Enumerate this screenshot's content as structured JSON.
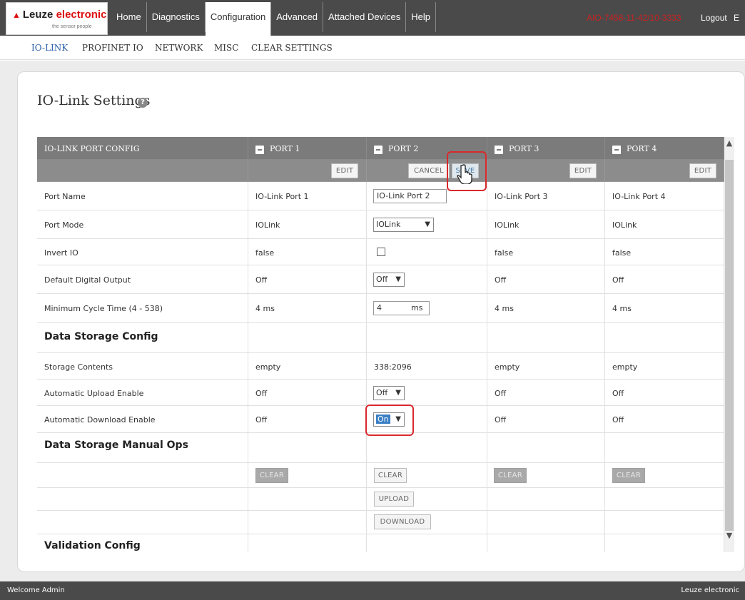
{
  "brand": {
    "name_part1": "Leuze",
    "name_part2": "electronic",
    "tagline": "the sensor people"
  },
  "nav": {
    "tabs": [
      "Home",
      "Diagnostics",
      "Configuration",
      "Advanced",
      "Attached Devices",
      "Help"
    ],
    "active": "Configuration"
  },
  "header": {
    "serial": "AIO-7458-11-42/10-3333",
    "logout": "Logout",
    "lang": "E"
  },
  "subnav": {
    "items": [
      "IO-LINK",
      "PROFINET IO",
      "NETWORK",
      "MISC",
      "CLEAR SETTINGS"
    ],
    "active": "IO-LINK"
  },
  "page": {
    "title": "IO-Link Settings"
  },
  "table": {
    "header_label": "IO-LINK PORT CONFIG",
    "ports": [
      "PORT 1",
      "PORT 2",
      "PORT 3",
      "PORT 4"
    ],
    "edit_label": "EDIT",
    "cancel_label": "CANCEL",
    "save_label": "SAVE",
    "rows": {
      "port_name": {
        "label": "Port Name",
        "values": [
          "IO-Link Port 1",
          "IO-Link Port 2",
          "IO-Link Port 3",
          "IO-Link Port 4"
        ]
      },
      "port_mode": {
        "label": "Port Mode",
        "values": [
          "IOLink",
          "IOLink",
          "IOLink",
          "IOLink"
        ]
      },
      "invert_io": {
        "label": "Invert IO",
        "values": [
          "false",
          "",
          "false",
          "false"
        ]
      },
      "default_digital_output": {
        "label": "Default Digital Output",
        "values": [
          "Off",
          "Off",
          "Off",
          "Off"
        ]
      },
      "min_cycle_time": {
        "label": "Minimum Cycle Time (4 - 538)",
        "values": [
          "4 ms",
          "4",
          "4 ms",
          "4 ms"
        ],
        "unit": "ms"
      },
      "data_storage_config": {
        "label": "Data Storage Config"
      },
      "storage_contents": {
        "label": "Storage Contents",
        "values": [
          "empty",
          "338:2096",
          "empty",
          "empty"
        ]
      },
      "auto_upload": {
        "label": "Automatic Upload Enable",
        "values": [
          "Off",
          "Off",
          "Off",
          "Off"
        ]
      },
      "auto_download": {
        "label": "Automatic Download Enable",
        "values": [
          "Off",
          "On",
          "Off",
          "Off"
        ]
      },
      "data_storage_manual_ops": {
        "label": "Data Storage Manual Ops"
      },
      "validation_config": {
        "label": "Validation Config"
      }
    },
    "clear_label": "CLEAR",
    "upload_label": "UPLOAD",
    "download_label": "DOWNLOAD"
  },
  "footer": {
    "welcome": "Welcome Admin",
    "brand": "Leuze electronic"
  },
  "colors": {
    "topbar": "#4a4a4a",
    "table_header": "#7b7b7b",
    "highlight": "#d9292d",
    "active_link": "#2a5fa8"
  }
}
